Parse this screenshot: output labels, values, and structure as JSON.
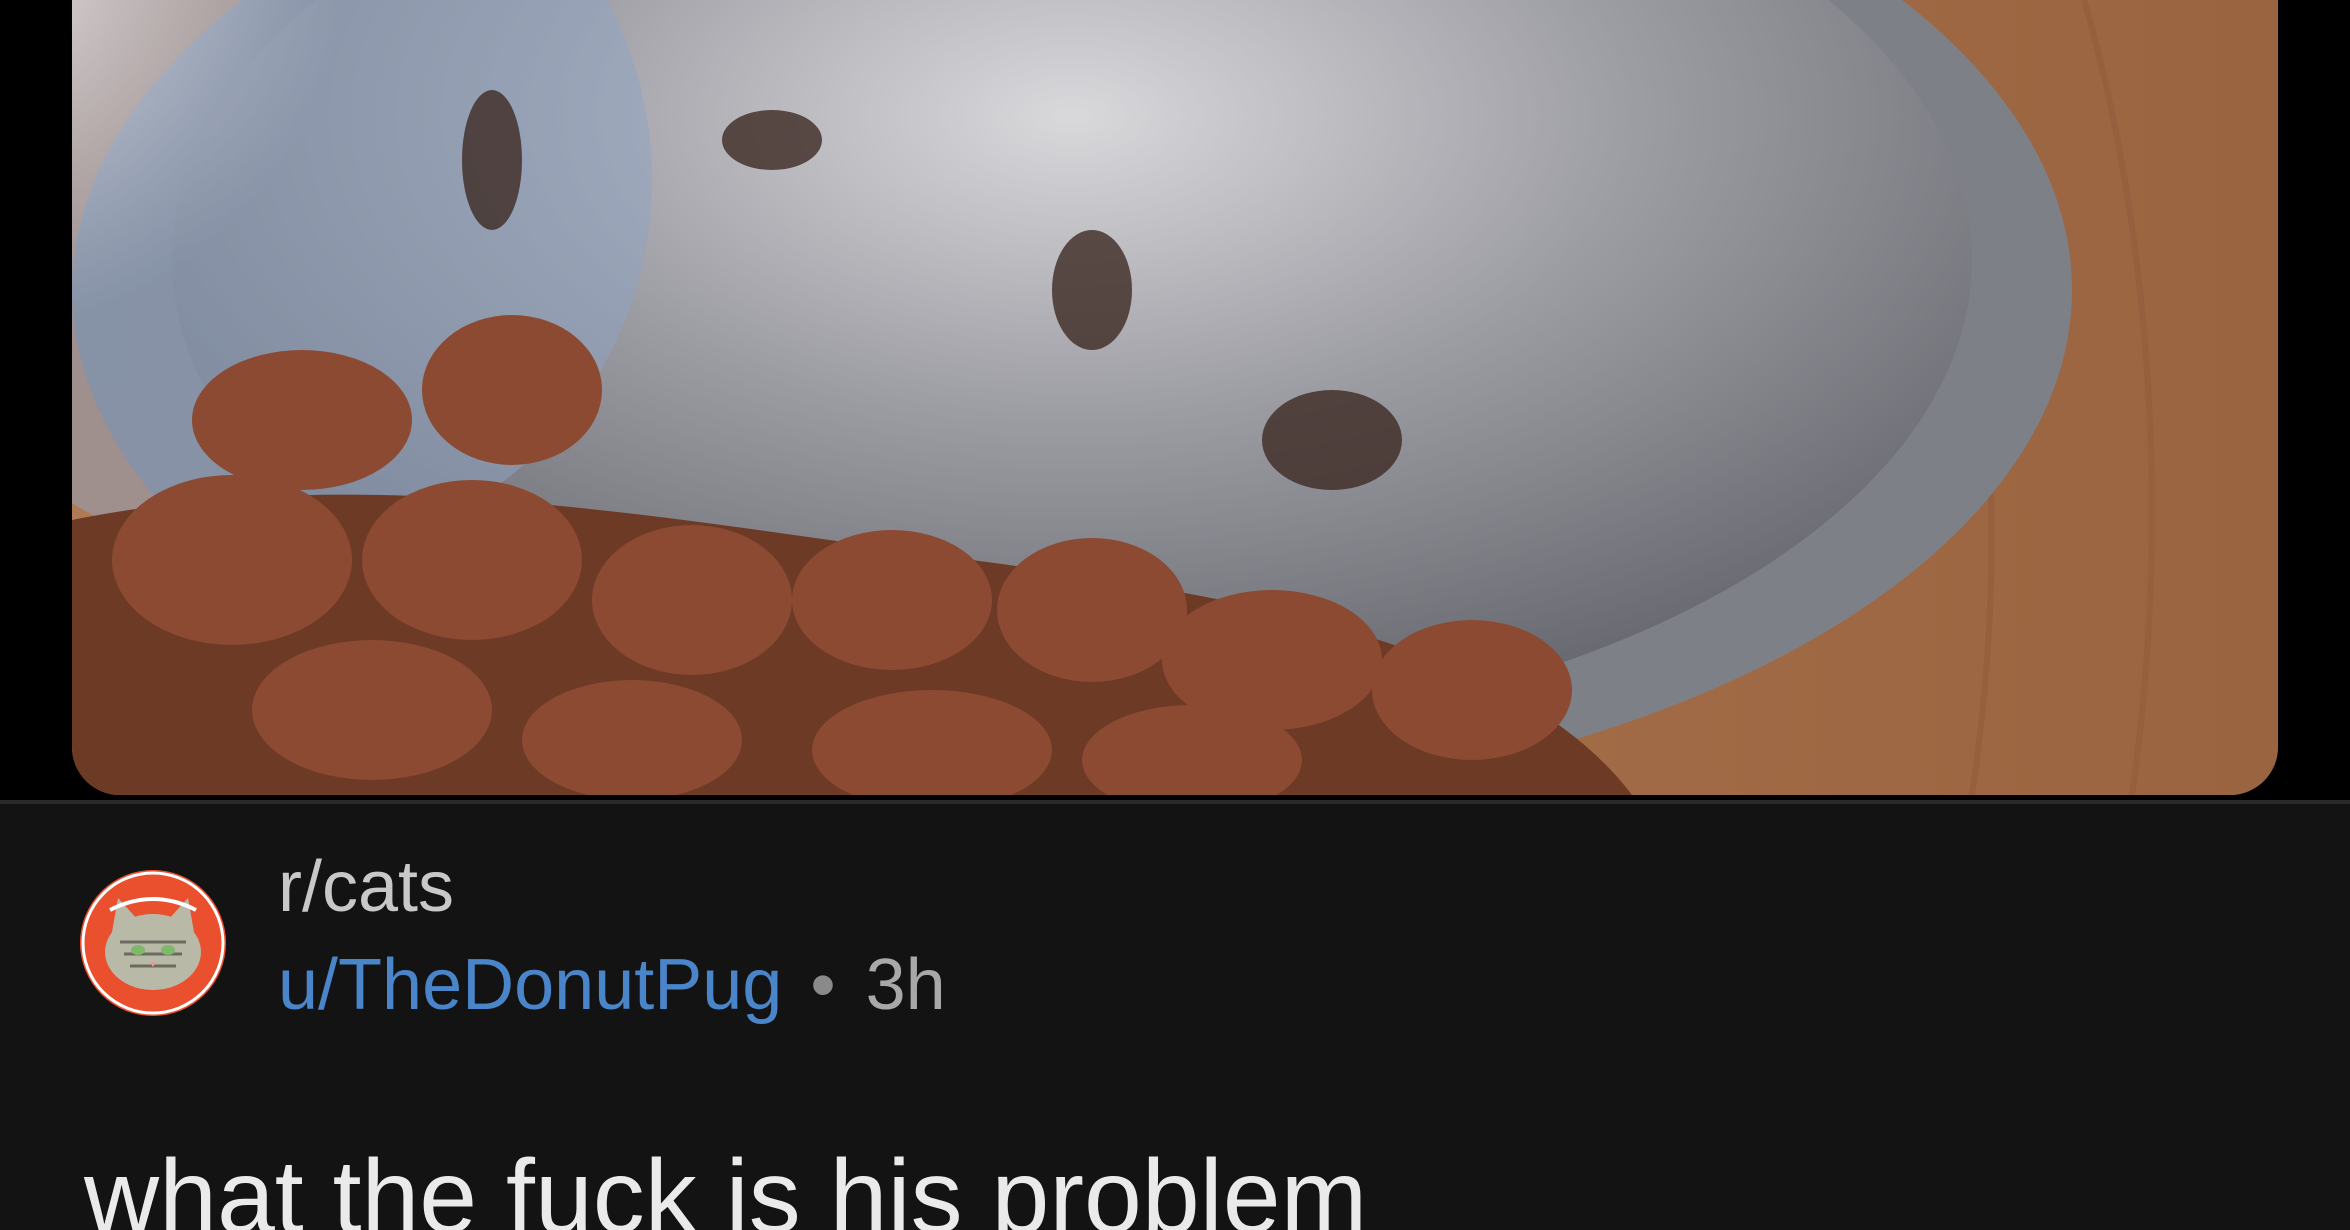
{
  "post": {
    "subreddit": "r/cats",
    "author": "u/TheDonutPug",
    "separator": "•",
    "age": "3h",
    "title": "what the fuck is his problem"
  },
  "media": {
    "description_icon": "photo-of-food-bowl"
  },
  "colors": {
    "background": "#000000",
    "card": "#131313",
    "username": "#4a84c9",
    "avatar": "#ea4f2e",
    "title": "#eaeaea"
  }
}
